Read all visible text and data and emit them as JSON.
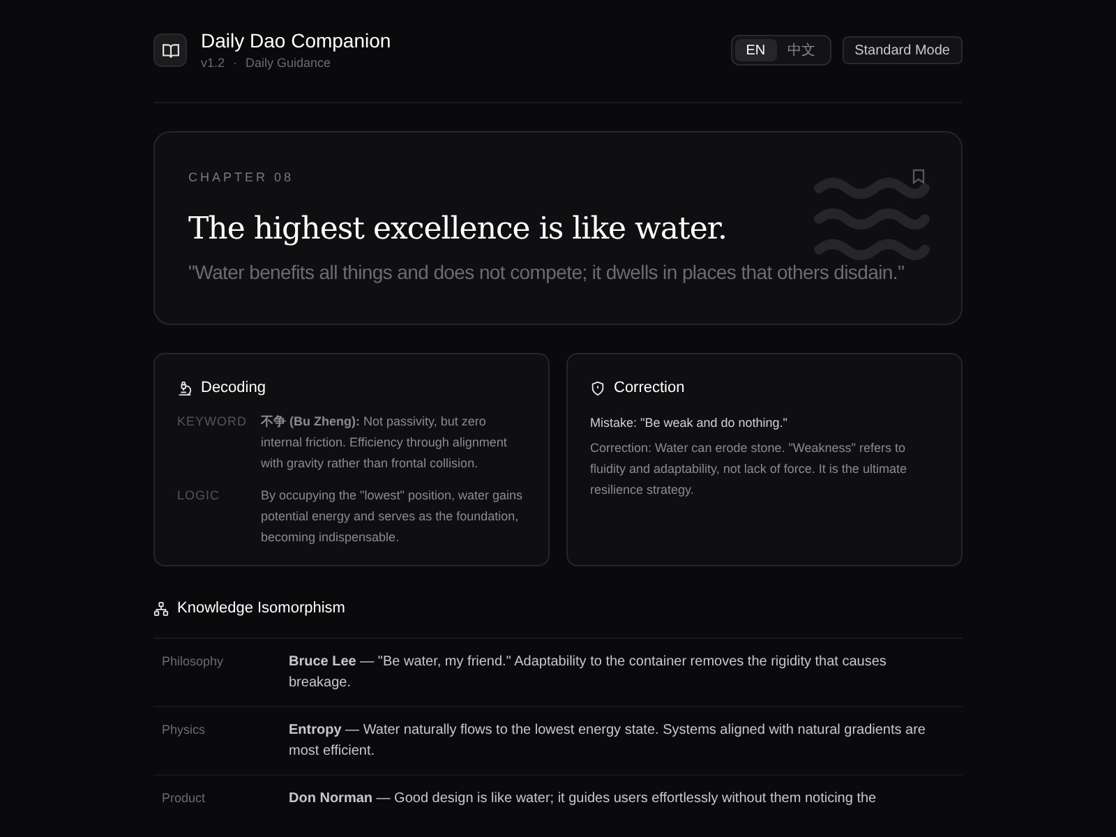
{
  "header": {
    "title": "Daily Dao Companion",
    "version": "v1.2",
    "separator": "·",
    "subtitle": "Daily Guidance",
    "languages": [
      {
        "label": "EN",
        "selected": true
      },
      {
        "label": "中文",
        "selected": false
      }
    ],
    "mode_button": "Standard Mode"
  },
  "chapter": {
    "label": "CHAPTER 08",
    "title": "The highest excellence is like water.",
    "quote": "\"Water benefits all things and does not compete; it dwells in places that others disdain.\""
  },
  "decoding": {
    "title": "Decoding",
    "rows": [
      {
        "key": "KEYWORD",
        "text": "**不争 (Bu Zheng):** Not passivity, but zero internal friction. Efficiency through alignment with gravity rather than frontal collision."
      },
      {
        "key": "LOGIC",
        "text": "By occupying the \"lowest\" position, water gains potential energy and serves as the foundation, becoming indispensable."
      }
    ]
  },
  "correction": {
    "title": "Correction",
    "mistake": "Mistake: \"Be weak and do nothing.\"",
    "text": "Correction: Water can erode stone. \"Weakness\" refers to fluidity and adaptability, not lack of force. It is the ultimate resilience strategy."
  },
  "isomorphism": {
    "title": "Knowledge Isomorphism",
    "rows": [
      {
        "field": "Philosophy",
        "text": "**Bruce Lee** — \"Be water, my friend.\" Adaptability to the container removes the rigidity that causes breakage."
      },
      {
        "field": "Physics",
        "text": "**Entropy** — Water naturally flows to the lowest energy state. Systems aligned with natural gradients are most efficient."
      },
      {
        "field": "Product",
        "text": "**Don Norman** — Good design is like water; it guides users effortlessly without them noticing the"
      }
    ]
  }
}
